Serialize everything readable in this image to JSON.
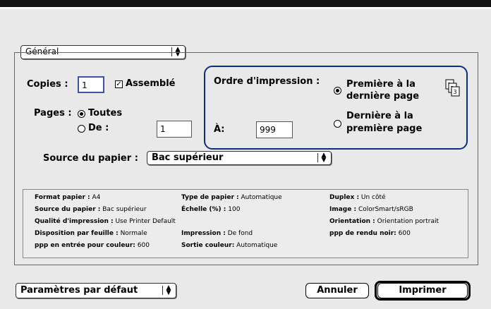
{
  "panel_popup": {
    "value": "Général"
  },
  "copies": {
    "label": "Copies :",
    "value": "1",
    "collate_label": "Assemblé",
    "collate_checked": true
  },
  "pages": {
    "label": "Pages :",
    "all_label": "Toutes",
    "from_label": "De :",
    "from_value": "1",
    "to_label": "À:",
    "to_value": "999"
  },
  "print_order": {
    "label": "Ordre d'impression :",
    "option1_line1": "Première à la",
    "option1_line2": "dernière page",
    "option2_line1": "Dernière à la",
    "option2_line2": "première page"
  },
  "paper_source": {
    "label": "Source du papier :",
    "value": "Bac supérieur"
  },
  "summary": {
    "col1": [
      {
        "key": "Format papier :",
        "val": "A4"
      },
      {
        "key": "Source du papier :",
        "val": "Bac supérieur"
      },
      {
        "key": "Qualité d'impression :",
        "val": "Use Printer Default"
      },
      {
        "key": "Disposition par feuille :",
        "val": "Normale"
      },
      {
        "key": "ppp en entrée pour couleur:",
        "val": "600"
      }
    ],
    "col2": [
      {
        "key": "Type de papier :",
        "val": "Automatique"
      },
      {
        "key": "Échelle (%) :",
        "val": "100"
      },
      {
        "key": "Impression :",
        "val": "De fond"
      },
      {
        "key": "Sortie couleur:",
        "val": "Automatique"
      }
    ],
    "col3": [
      {
        "key": "Duplex :",
        "val": "Un côté"
      },
      {
        "key": "Image :",
        "val": "ColorSmart/sRGB"
      },
      {
        "key": "Orientation :",
        "val": "Orientation portrait"
      },
      {
        "key": "ppp de rendu noir:",
        "val": "600"
      }
    ]
  },
  "presets_popup": {
    "value": "Paramètres par défaut"
  },
  "buttons": {
    "cancel": "Annuler",
    "print": "Imprimer"
  },
  "colors": {
    "focus_ring": "#0b2c83",
    "dialog_bg": "#e9e9e9"
  }
}
